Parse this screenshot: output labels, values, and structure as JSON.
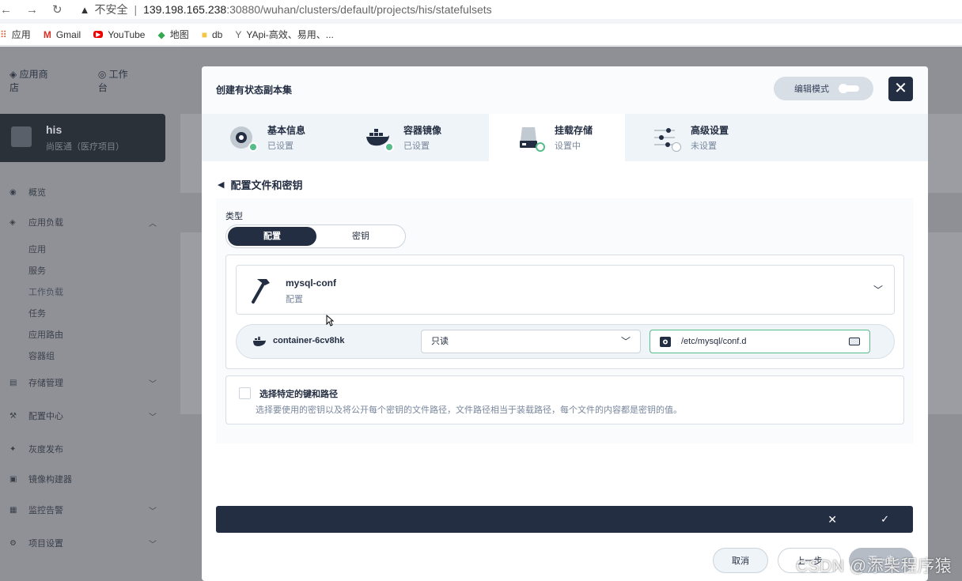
{
  "browser": {
    "insecure_label": "不安全",
    "url_host": "139.198.165.238",
    "url_path": ":30880/wuhan/clusters/default/projects/his/statefulsets",
    "bookmarks": [
      {
        "label": "应用",
        "icon": "apps-grid-icon"
      },
      {
        "label": "Gmail",
        "icon": "gmail-icon"
      },
      {
        "label": "YouTube",
        "icon": "youtube-icon"
      },
      {
        "label": "地图",
        "icon": "maps-icon"
      },
      {
        "label": "db",
        "icon": "folder-icon"
      },
      {
        "label": "YApi-高效、易用、...",
        "icon": "yapi-icon"
      }
    ]
  },
  "app": {
    "top_nav": [
      "应用商店",
      "工作台"
    ],
    "project": {
      "name": "his",
      "subtitle": "尚医通（医疗项目）"
    },
    "menu": [
      {
        "label": "概览"
      },
      {
        "label": "应用负载"
      },
      {
        "label": "存储管理"
      },
      {
        "label": "配置中心"
      },
      {
        "label": "灰度发布"
      },
      {
        "label": "镜像构建器"
      },
      {
        "label": "监控告警"
      },
      {
        "label": "项目设置"
      }
    ],
    "submenu": [
      "应用",
      "服务",
      "工作负载",
      "任务",
      "应用路由",
      "容器组"
    ]
  },
  "modal": {
    "title": "创建有状态副本集",
    "edit_mode_label": "编辑模式",
    "steps": [
      {
        "title": "基本信息",
        "status": "已设置"
      },
      {
        "title": "容器镜像",
        "status": "已设置"
      },
      {
        "title": "挂载存储",
        "status": "设置中"
      },
      {
        "title": "高级设置",
        "status": "未设置"
      }
    ],
    "section_title": "配置文件和密钥",
    "type_label": "类型",
    "type_options": [
      "配置",
      "密钥"
    ],
    "selected_resource": {
      "name": "mysql-conf",
      "type": "配置"
    },
    "mount": {
      "container": "container-6cv8hk",
      "access_mode": "只读",
      "mount_path": "/etc/mysql/conf.d"
    },
    "specific_keys": {
      "title": "选择特定的键和路径",
      "description": "选择要使用的密钥以及将公开每个密钥的文件路径，文件路径相当于装载路径，每个文件的内容都是密钥的值。"
    },
    "buttons": {
      "cancel": "取消",
      "prev": "上一步",
      "next": "下一步"
    }
  },
  "watermark": "CSDN @添柴程序猿",
  "colors": {
    "dark": "#242e42",
    "accent_green": "#55bc8a",
    "overlay": "#8e9095"
  }
}
